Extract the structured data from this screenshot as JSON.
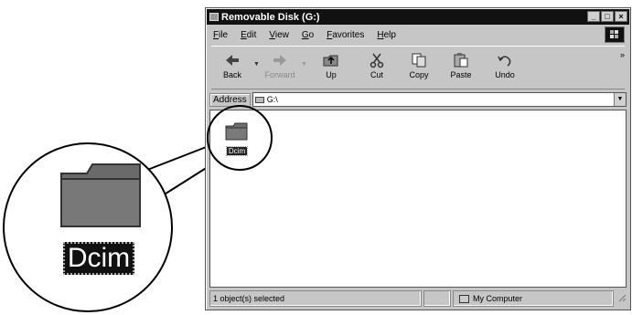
{
  "window": {
    "title": "Removable Disk (G:)",
    "buttons": {
      "minimize": "_",
      "maximize": "□",
      "close": "×"
    }
  },
  "menu": {
    "items": [
      "File",
      "Edit",
      "View",
      "Go",
      "Favorites",
      "Help"
    ]
  },
  "toolbar": {
    "back": "Back",
    "forward": "Forward",
    "up": "Up",
    "cut": "Cut",
    "copy": "Copy",
    "paste": "Paste",
    "undo": "Undo",
    "more": "»"
  },
  "address": {
    "label": "Address",
    "value": "G:\\"
  },
  "content": {
    "items": [
      {
        "name": "Dcim",
        "icon": "folder-icon",
        "selected": true
      }
    ]
  },
  "status": {
    "selection": "1 object(s) selected",
    "location": "My Computer"
  },
  "callout": {
    "label": "Dcim"
  },
  "colors": {
    "titlebar": "#111111",
    "chrome": "#c6c6c6",
    "folder": "#6e6e6e"
  }
}
